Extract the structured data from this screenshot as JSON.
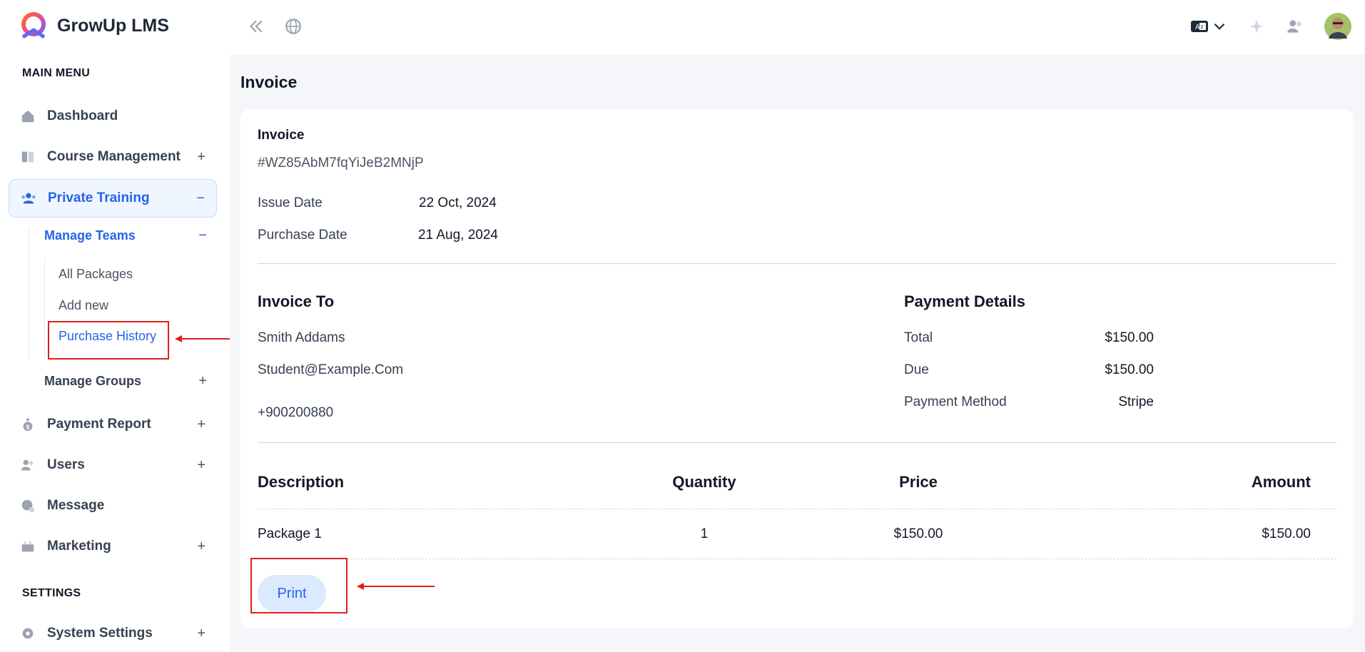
{
  "app": {
    "name": "GrowUp LMS"
  },
  "sidebar": {
    "main_menu_label": "MAIN MENU",
    "settings_label": "SETTINGS",
    "items": [
      {
        "label": "Dashboard",
        "icon": "home-icon",
        "expand": ""
      },
      {
        "label": "Course Management",
        "icon": "book-icon",
        "expand": "+"
      },
      {
        "label": "Private Training",
        "icon": "training-icon",
        "expand": "−"
      },
      {
        "label": "Payment Report",
        "icon": "money-bag-icon",
        "expand": "+"
      },
      {
        "label": "Users",
        "icon": "users-icon",
        "expand": "+"
      },
      {
        "label": "Message",
        "icon": "message-icon",
        "expand": ""
      },
      {
        "label": "Marketing",
        "icon": "marketing-icon",
        "expand": "+"
      },
      {
        "label": "System Settings",
        "icon": "gear-icon",
        "expand": "+"
      }
    ],
    "sub": {
      "manage_teams": {
        "label": "Manage Teams",
        "expand": "−"
      },
      "manage_groups": {
        "label": "Manage Groups",
        "expand": "+"
      },
      "leaves": [
        "All Packages",
        "Add new",
        "Purchase History"
      ]
    }
  },
  "page": {
    "title": "Invoice"
  },
  "invoice": {
    "heading": "Invoice",
    "number": "#WZ85AbM7fqYiJeB2MNjP",
    "issue_label": "Issue Date",
    "issue_date": "22 Oct, 2024",
    "purchase_label": "Purchase Date",
    "purchase_date": "21 Aug, 2024",
    "to": {
      "heading": "Invoice To",
      "name": "Smith Addams",
      "email": "Student@Example.Com",
      "phone": "+900200880"
    },
    "payment": {
      "heading": "Payment Details",
      "total_label": "Total",
      "total": "$150.00",
      "due_label": "Due",
      "due": "$150.00",
      "method_label": "Payment Method",
      "method": "Stripe"
    },
    "table": {
      "headers": [
        "Description",
        "Quantity",
        "Price",
        "Amount"
      ],
      "rows": [
        [
          "Package 1",
          "1",
          "$150.00",
          "$150.00"
        ]
      ]
    },
    "print_label": "Print"
  },
  "colors": {
    "accent": "#2563eb",
    "annotation": "#e11d1d"
  }
}
